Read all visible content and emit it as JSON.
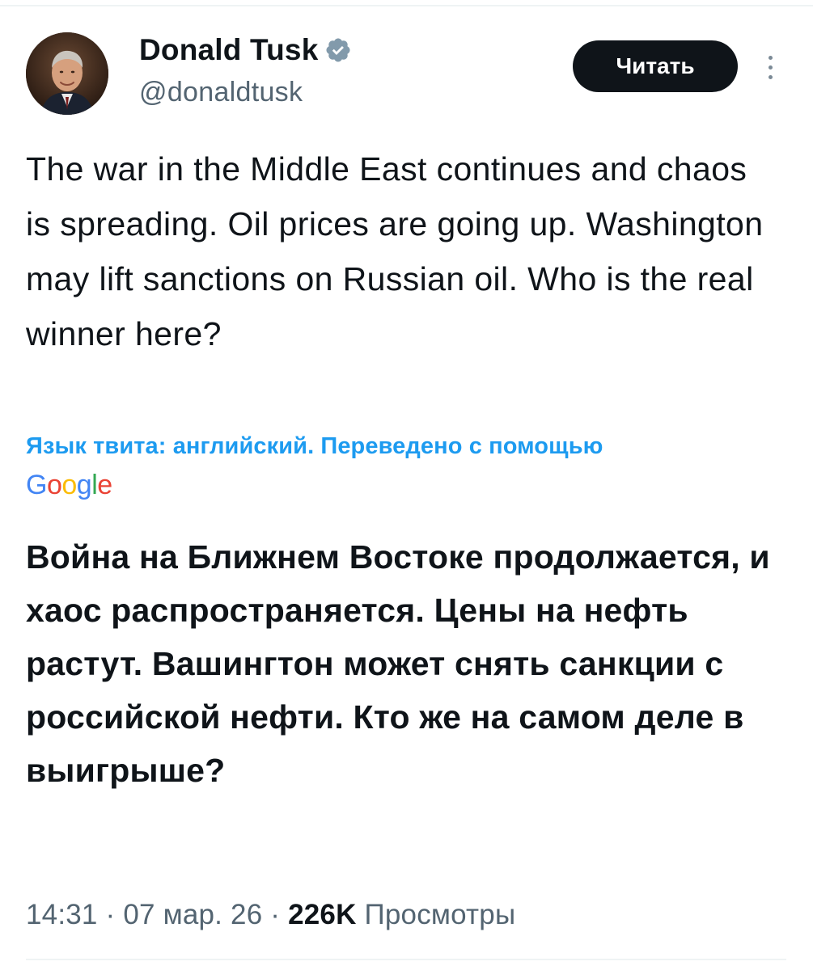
{
  "author": {
    "display_name": "Donald Tusk",
    "handle": "@donaldtusk",
    "verified": true
  },
  "header": {
    "read_button_label": "Читать",
    "more_icon": "vertical-dots-icon"
  },
  "tweet": {
    "text": "The war in the Middle East continues and chaos is spreading. Oil prices are going up. Washington may lift sanctions on Russian oil. Who is the real winner here?",
    "translation_note": "Язык твита: английский. Переведено с помощью",
    "translation_provider": "Google",
    "translated_text": "Война на Ближнем Востоке продолжается, и хаос распространяется. Цены на нефть растут. Вашингтон может снять санкции с российской нефти. Кто же на самом деле в выигрыше?"
  },
  "meta": {
    "time": "14:31",
    "sep1": "·",
    "date": "07 мар. 26",
    "sep2": "·",
    "views_count": "226K",
    "views_label": "Просмотры"
  },
  "colors": {
    "text": "#0f1419",
    "secondary": "#536471",
    "link": "#1d9bf0",
    "verified": "#829aab",
    "button_bg": "#0f1419"
  }
}
